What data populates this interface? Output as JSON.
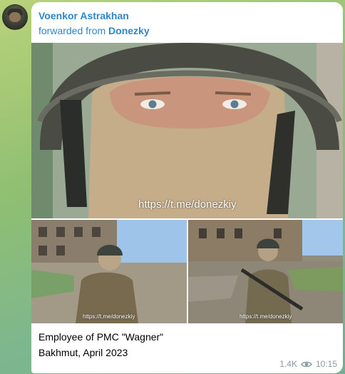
{
  "message": {
    "sender": "Voenkor Astrakhan",
    "forwarded_prefix": "forwarded from",
    "forwarded_from": "Donezky",
    "caption_line1": "Employee of PMC \"Wagner\"",
    "caption_line2": "Bakhmut, April 2023",
    "views": "1.4K",
    "time": "10:15"
  },
  "photos": {
    "main_watermark": "https://t.me/donezkiy",
    "left_watermark": "https://t.me/donezkiy",
    "right_watermark": "https://t.me/donezkiy"
  },
  "icons": {
    "views": "eye-icon"
  },
  "colors": {
    "accent": "#2f86c9",
    "meta": "#8a9aa6",
    "chat_bg": "#9cc47a"
  }
}
